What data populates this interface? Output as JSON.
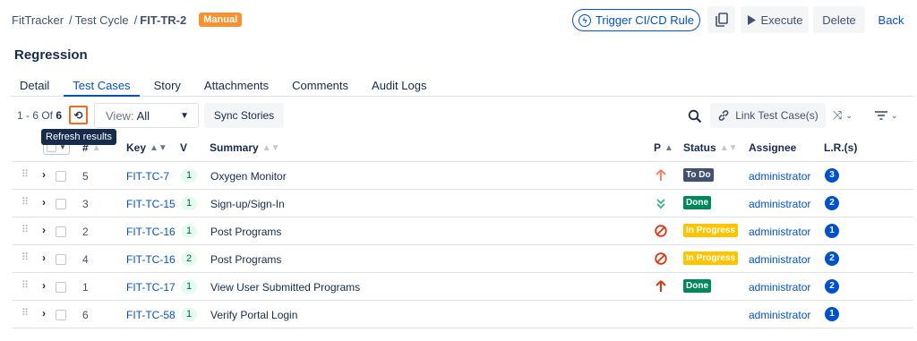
{
  "breadcrumb": {
    "app": "FitTracker",
    "section": "Test Cycle",
    "current": "FIT-TR-2",
    "badge": "Manual"
  },
  "actions": {
    "trigger": "Trigger CI/CD Rule",
    "execute": "Execute",
    "delete": "Delete",
    "back": "Back"
  },
  "section_title": "Regression",
  "tabs": [
    {
      "label": "Detail",
      "active": false
    },
    {
      "label": "Test Cases",
      "active": true
    },
    {
      "label": "Story",
      "active": false
    },
    {
      "label": "Attachments",
      "active": false
    },
    {
      "label": "Comments",
      "active": false
    },
    {
      "label": "Audit Logs",
      "active": false
    }
  ],
  "toolbar": {
    "range_prefix": "1 - 6 Of",
    "range_total": "6",
    "view_label": "View:",
    "view_value": "All",
    "sync": "Sync Stories",
    "link": "Link Test Case(s)",
    "tooltip": "Refresh results"
  },
  "columns": {
    "num": "#",
    "key": "Key",
    "ver": "V",
    "summary": "Summary",
    "prio": "P",
    "status": "Status",
    "assignee": "Assignee",
    "lr": "L.R.(s)"
  },
  "colors": {
    "accent": "#0052cc",
    "todo": "#42526e",
    "done": "#00875a",
    "progress": "#ffc400",
    "manual": "#f79232",
    "high": "#ff5630"
  },
  "rows": [
    {
      "num": "5",
      "key": "FIT-TC-7",
      "ver": "1",
      "summary": "Oxygen Monitor",
      "priority": "arrow-up-icon",
      "status": "To Do",
      "status_kind": "todo",
      "assignee": "administrator",
      "lr": "3"
    },
    {
      "num": "3",
      "key": "FIT-TC-15",
      "ver": "1",
      "summary": "Sign-up/Sign-In",
      "priority": "double-chevron-down-icon",
      "status": "Done",
      "status_kind": "done",
      "assignee": "administrator",
      "lr": "2"
    },
    {
      "num": "2",
      "key": "FIT-TC-16",
      "ver": "1",
      "summary": "Post Programs",
      "priority": "blocker-icon",
      "status": "In Progress",
      "status_kind": "prog",
      "assignee": "administrator",
      "lr": "1"
    },
    {
      "num": "4",
      "key": "FIT-TC-16",
      "ver": "2",
      "summary": "Post Programs",
      "priority": "blocker-icon",
      "status": "In Progress",
      "status_kind": "prog",
      "assignee": "administrator",
      "lr": "2"
    },
    {
      "num": "1",
      "key": "FIT-TC-17",
      "ver": "1",
      "summary": "View User Submitted Programs",
      "priority": "critical-arrow-icon",
      "status": "Done",
      "status_kind": "done",
      "assignee": "administrator",
      "lr": "2"
    },
    {
      "num": "6",
      "key": "FIT-TC-58",
      "ver": "1",
      "summary": "Verify Portal Login",
      "priority": "",
      "status": "",
      "status_kind": "",
      "assignee": "administrator",
      "lr": "1"
    }
  ]
}
